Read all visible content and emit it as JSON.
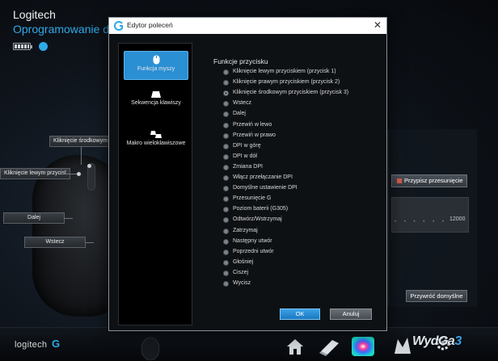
{
  "app": {
    "title": "Logitech",
    "subtitle": "Oprogramowanie d"
  },
  "callouts": {
    "middle_click": "Kliknięcie środkowym p",
    "left_click": "Kliknięcie lewym przycisl",
    "forward": "Dalej",
    "back": "Wstecz"
  },
  "right_panel": {
    "assign_label": "Przypisz przesunięcie",
    "dpi_value": "12000",
    "dpi_dots": "• • • • • •",
    "restore_label": "Przywróć domyślne"
  },
  "bottom_bar": {
    "brand": "logitech",
    "watermark_a": "WydGa",
    "watermark_b": "3"
  },
  "dialog": {
    "title": "Edytor poleceń",
    "close_symbol": "✕",
    "sidebar": [
      {
        "label": "Funkcja myszy",
        "active": true,
        "icon": "mouse-icon"
      },
      {
        "label": "Sekwencja klawiszy",
        "active": false,
        "icon": "keystroke-icon"
      },
      {
        "label": "Makro wieloklawiszowe",
        "active": false,
        "icon": "multikey-icon"
      }
    ],
    "section_title": "Funkcje przycisku",
    "options": [
      "Kliknięcie lewym przyciskiem (przycisk 1)",
      "Kliknięcie prawym przyciskiem (przycisk 2)",
      "Kliknięcie środkowym przyciskiem (przycisk 3)",
      "Wstecz",
      "Dalej",
      "Przewiń w lewo",
      "Przewiń w prawo",
      "DPI w górę",
      "DPI w dół",
      "Zmiana DPI",
      "Włącz przełączanie DPI",
      "Domyślne ustawienie DPI",
      "Przesunięcie G",
      "Poziom baterii (G305)",
      "Odtwórz/Wstrzymaj",
      "Zatrzymaj",
      "Następny utwór",
      "Poprzedni utwór",
      "Głośniej",
      "Ciszej",
      "Wycisz"
    ],
    "selected_index": 2,
    "ok_label": "OK",
    "cancel_label": "Anuluj"
  },
  "colors": {
    "accent": "#2fa9e8",
    "active_tab": "#2b8fd3"
  }
}
